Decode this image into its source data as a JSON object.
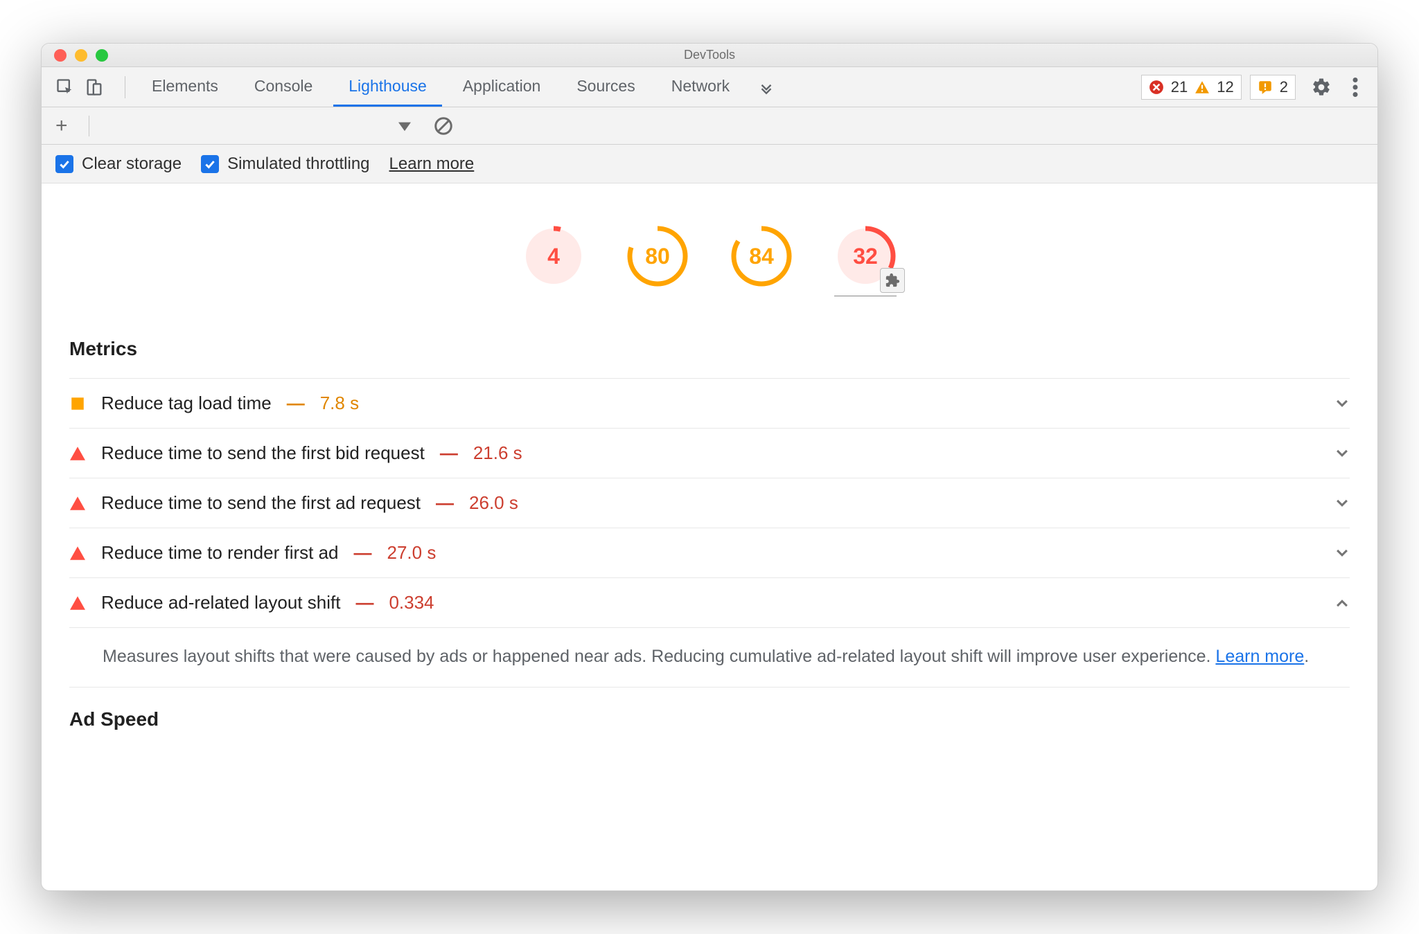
{
  "window": {
    "title": "DevTools"
  },
  "tabs": {
    "items": [
      "Elements",
      "Console",
      "Lighthouse",
      "Application",
      "Sources",
      "Network"
    ],
    "active": "Lighthouse"
  },
  "badges": {
    "errors": "21",
    "warnings": "12",
    "issues": "2"
  },
  "checkrow": {
    "clear_storage": "Clear storage",
    "simulated_throttling": "Simulated throttling",
    "learn_more": "Learn more"
  },
  "gauges": [
    {
      "score": "4",
      "color": "#ff4e42",
      "bg": "#ffeae8",
      "pct": 4
    },
    {
      "score": "80",
      "color": "#ffa400",
      "bg": "#ffffff",
      "pct": 80
    },
    {
      "score": "84",
      "color": "#ffa400",
      "bg": "#ffffff",
      "pct": 84
    },
    {
      "score": "32",
      "color": "#ff4e42",
      "bg": "#ffeae8",
      "pct": 32
    }
  ],
  "sections": {
    "metrics_title": "Metrics",
    "ad_speed_title": "Ad Speed"
  },
  "metrics": [
    {
      "icon": "square",
      "label": "Reduce tag load time",
      "value": "7.8 s",
      "severity": "orange",
      "expanded": false
    },
    {
      "icon": "triangle",
      "label": "Reduce time to send the first bid request",
      "value": "21.6 s",
      "severity": "red",
      "expanded": false
    },
    {
      "icon": "triangle",
      "label": "Reduce time to send the first ad request",
      "value": "26.0 s",
      "severity": "red",
      "expanded": false
    },
    {
      "icon": "triangle",
      "label": "Reduce time to render first ad",
      "value": "27.0 s",
      "severity": "red",
      "expanded": false
    },
    {
      "icon": "triangle",
      "label": "Reduce ad-related layout shift",
      "value": "0.334",
      "severity": "red",
      "expanded": true
    }
  ],
  "detail": {
    "text": "Measures layout shifts that were caused by ads or happened near ads. Reducing cumulative ad-related layout shift will improve user experience. ",
    "link": "Learn more",
    "suffix": "."
  }
}
